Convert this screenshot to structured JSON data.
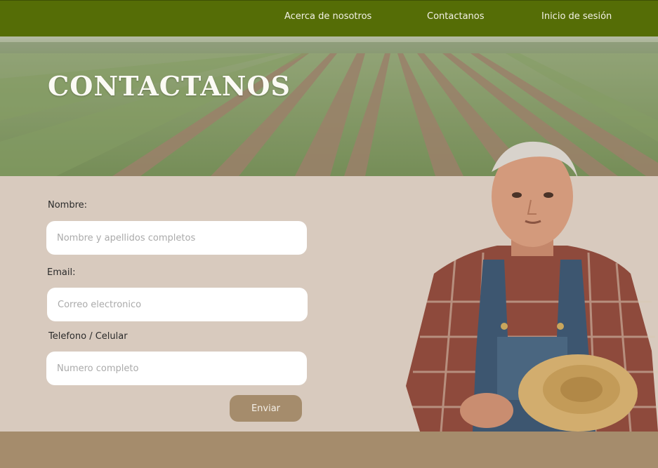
{
  "nav": {
    "about": "Acerca de nosotros",
    "contact": "Contactanos",
    "login": "Inicio de sesión"
  },
  "hero": {
    "title": "CONTACTANOS"
  },
  "form": {
    "name_label": "Nombre:",
    "name_placeholder": "Nombre y apellidos completos",
    "email_label": "Email:",
    "email_placeholder": "Correo electronico",
    "phone_label": "Telefono / Celular",
    "phone_placeholder": "Numero completo",
    "submit_label": "Enviar"
  },
  "colors": {
    "navbar": "#556d06",
    "form_background": "#d8cabe",
    "accent": "#a58c6c"
  },
  "images": {
    "hero": "crop-field-rows-photo",
    "portrait": "elderly-farmer-with-straw-hat-photo"
  }
}
